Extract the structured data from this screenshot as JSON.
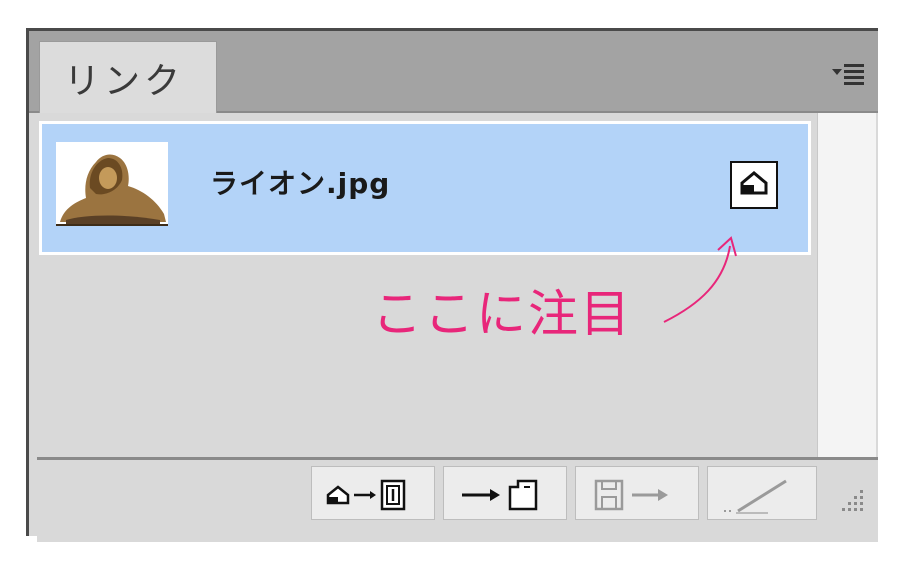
{
  "panel": {
    "tab_label": "リンク",
    "menu_icon": "panel-menu-icon"
  },
  "links": [
    {
      "filename": "ライオン.jpg",
      "thumbnail": "lion-thumbnail",
      "status_icon": "edit-original-icon",
      "selected": true
    }
  ],
  "annotation": {
    "text": "ここに注目",
    "color": "#e8267a"
  },
  "toolbar": {
    "buttons": [
      {
        "name": "relink-to-page-button",
        "icon": "relink-icon"
      },
      {
        "name": "go-to-link-button",
        "icon": "go-to-link-icon"
      },
      {
        "name": "update-link-button",
        "icon": "update-link-icon"
      },
      {
        "name": "edit-original-button",
        "icon": "pencil-icon"
      }
    ]
  },
  "colors": {
    "selection": "#b3d3f8",
    "panel_bg": "#d9d9d9",
    "tabbar_bg": "#a3a3a3"
  }
}
